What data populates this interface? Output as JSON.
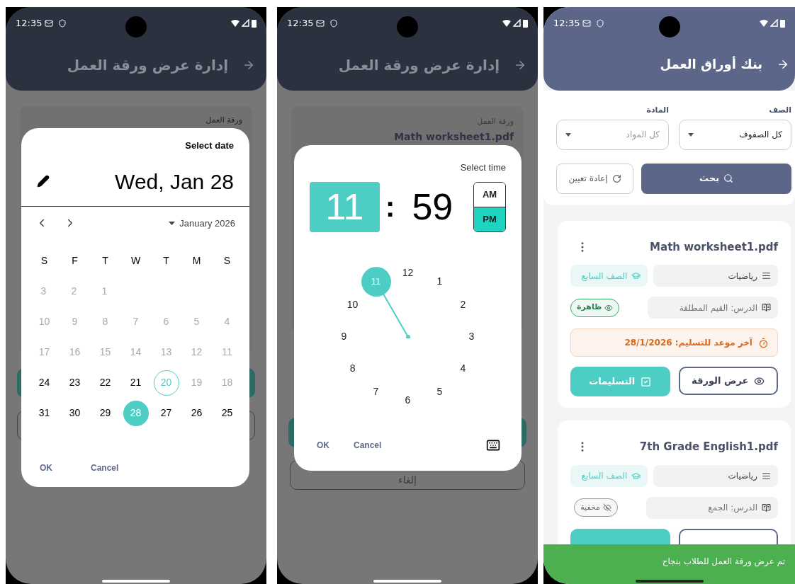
{
  "date_screen": {
    "status_time": "12:35",
    "header": {
      "title": "إدارة عرض ورقة العمل"
    },
    "background": {
      "field_label": "ورقة العمل"
    },
    "dialog": {
      "title": "Select date",
      "selected_date": "Wed, Jan 28",
      "month": "January 2026",
      "weekdays": [
        "S",
        "M",
        "T",
        "W",
        "T",
        "F",
        "S"
      ],
      "weeks": [
        {
          "partial": true,
          "days": [
            {
              "label": "1",
              "disabled": true,
              "today": false,
              "selected": false
            },
            {
              "label": "2",
              "disabled": true,
              "today": false,
              "selected": false
            },
            {
              "label": "3",
              "disabled": true,
              "today": false,
              "selected": false
            }
          ]
        },
        {
          "partial": false,
          "days": [
            {
              "label": "4",
              "disabled": true,
              "today": false,
              "selected": false
            },
            {
              "label": "5",
              "disabled": true,
              "today": false,
              "selected": false
            },
            {
              "label": "6",
              "disabled": true,
              "today": false,
              "selected": false
            },
            {
              "label": "7",
              "disabled": true,
              "today": false,
              "selected": false
            },
            {
              "label": "8",
              "disabled": true,
              "today": false,
              "selected": false
            },
            {
              "label": "9",
              "disabled": true,
              "today": false,
              "selected": false
            },
            {
              "label": "10",
              "disabled": true,
              "today": false,
              "selected": false
            }
          ]
        },
        {
          "partial": false,
          "days": [
            {
              "label": "11",
              "disabled": true,
              "today": false,
              "selected": false
            },
            {
              "label": "12",
              "disabled": true,
              "today": false,
              "selected": false
            },
            {
              "label": "13",
              "disabled": true,
              "today": false,
              "selected": false
            },
            {
              "label": "14",
              "disabled": true,
              "today": false,
              "selected": false
            },
            {
              "label": "15",
              "disabled": true,
              "today": false,
              "selected": false
            },
            {
              "label": "16",
              "disabled": true,
              "today": false,
              "selected": false
            },
            {
              "label": "17",
              "disabled": true,
              "today": false,
              "selected": false
            }
          ]
        },
        {
          "partial": false,
          "days": [
            {
              "label": "18",
              "disabled": true,
              "today": false,
              "selected": false
            },
            {
              "label": "19",
              "disabled": true,
              "today": false,
              "selected": false
            },
            {
              "label": "20",
              "disabled": false,
              "today": true,
              "selected": false
            },
            {
              "label": "21",
              "disabled": false,
              "today": false,
              "selected": false
            },
            {
              "label": "22",
              "disabled": false,
              "today": false,
              "selected": false
            },
            {
              "label": "23",
              "disabled": false,
              "today": false,
              "selected": false
            },
            {
              "label": "24",
              "disabled": false,
              "today": false,
              "selected": false
            }
          ]
        },
        {
          "partial": false,
          "days": [
            {
              "label": "25",
              "disabled": false,
              "today": false,
              "selected": false
            },
            {
              "label": "26",
              "disabled": false,
              "today": false,
              "selected": false
            },
            {
              "label": "27",
              "disabled": false,
              "today": false,
              "selected": false
            },
            {
              "label": "28",
              "disabled": false,
              "today": false,
              "selected": true
            },
            {
              "label": "29",
              "disabled": false,
              "today": false,
              "selected": false
            },
            {
              "label": "30",
              "disabled": false,
              "today": false,
              "selected": false
            },
            {
              "label": "31",
              "disabled": false,
              "today": false,
              "selected": false
            }
          ]
        }
      ],
      "actions": [
        "Cancel",
        "OK"
      ]
    }
  },
  "time_screen": {
    "status_time": "12:35",
    "header": {
      "title": "إدارة عرض ورقة العمل"
    },
    "background": {
      "field_label": "ورقة العمل",
      "field_value": "Math worksheet1.pdf",
      "cancel_button": "إلغاء"
    },
    "dialog": {
      "title": "Select time",
      "hour": "11",
      "separator": ":",
      "minute": "59",
      "periods": [
        {
          "label": "AM",
          "selected": false
        },
        {
          "label": "PM",
          "selected": true
        }
      ],
      "dial": [
        {
          "label": "12",
          "selected": false
        },
        {
          "label": "1",
          "selected": false
        },
        {
          "label": "2",
          "selected": false
        },
        {
          "label": "3",
          "selected": false
        },
        {
          "label": "4",
          "selected": false
        },
        {
          "label": "5",
          "selected": false
        },
        {
          "label": "6",
          "selected": false
        },
        {
          "label": "7",
          "selected": false
        },
        {
          "label": "8",
          "selected": false
        },
        {
          "label": "9",
          "selected": false
        },
        {
          "label": "10",
          "selected": false
        },
        {
          "label": "11",
          "selected": true
        }
      ],
      "actions": [
        "Cancel",
        "OK"
      ]
    }
  },
  "bank_screen": {
    "status_time": "12:35",
    "header": {
      "title": "بنك أوراق العمل"
    },
    "filters": [
      {
        "label": "الصف",
        "value": "كل الصفوف"
      },
      {
        "label": "المادة",
        "placeholder": "كل المواد"
      }
    ],
    "search_button": "بحث",
    "reset_button": "إعادة تعيين",
    "worksheets": [
      {
        "title": "Math worksheet1.pdf",
        "subject": "رياضيات",
        "grade": "الصف السابع",
        "lesson": "الدرس: القيم المطلقة",
        "visibility": {
          "visible": true,
          "label": "ظاهرة"
        },
        "deadline": "آخر موعد للتسليم: 28/1/2026",
        "view_button": "عرض الورقة",
        "submissions_button": "التسليمات"
      },
      {
        "title": "7th Grade English1.pdf",
        "subject": "رياضيات",
        "grade": "الصف السابع",
        "lesson": "الدرس: الجمع",
        "visibility": {
          "visible": false,
          "label": "مخفية"
        }
      }
    ],
    "snackbar": "تم عرض ورقة العمل للطلاب بنجاح"
  }
}
